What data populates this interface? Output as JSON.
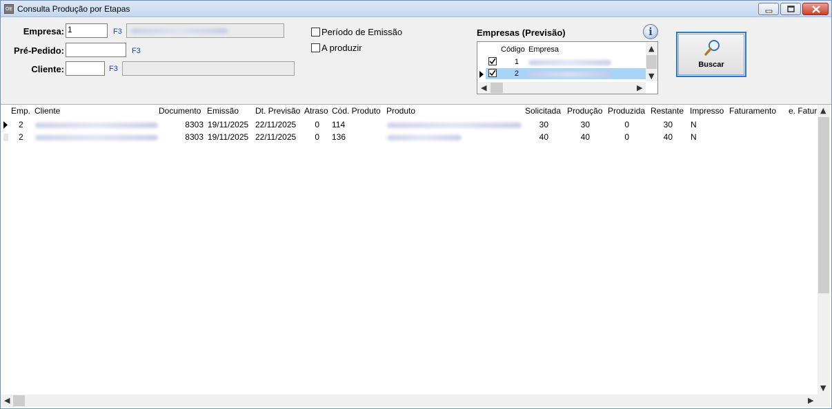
{
  "window": {
    "icon_text": "OE",
    "title": "Consulta Produção por Etapas"
  },
  "filters": {
    "empresa_label": "Empresa:",
    "empresa_value": "1",
    "pre_pedido_label": "Pré-Pedido:",
    "pre_pedido_value": "",
    "cliente_label": "Cliente:",
    "cliente_value": "",
    "f3_label": "F3",
    "periodo_label": "Período de Emissão",
    "a_produzir_label": "A produzir"
  },
  "empresas_previsao": {
    "title": "Empresas (Previsão)",
    "info_glyph": "i",
    "columns": [
      "Código",
      "Empresa"
    ],
    "rows": [
      {
        "codigo": "1",
        "checked": true
      },
      {
        "codigo": "2",
        "checked": true
      }
    ]
  },
  "buscar_label": "Buscar",
  "grid": {
    "columns": [
      "Emp.",
      "Cliente",
      "Documento",
      "Emissão",
      "Dt. Previsão",
      "Atraso",
      "Cód. Produto",
      "Produto",
      "Solicitada",
      "Produção",
      "Produzida",
      "Restante",
      "Impresso",
      "Faturamento",
      "e. Fatur"
    ],
    "rows": [
      {
        "emp": "2",
        "documento": "8303",
        "emissao": "19/11/2025",
        "dt_previsao": "22/11/2025",
        "atraso": "0",
        "cod_produto": "114",
        "solicitada": "30",
        "producao": "30",
        "produzida": "0",
        "restante": "30",
        "impresso": "N"
      },
      {
        "emp": "2",
        "documento": "8303",
        "emissao": "19/11/2025",
        "dt_previsao": "22/11/2025",
        "atraso": "0",
        "cod_produto": "136",
        "solicitada": "40",
        "producao": "40",
        "produzida": "0",
        "restante": "40",
        "impresso": "N"
      }
    ]
  }
}
